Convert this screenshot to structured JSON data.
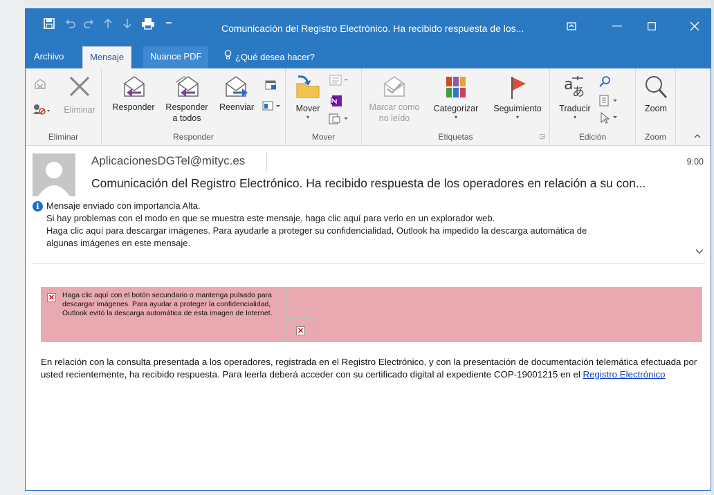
{
  "window": {
    "title": "Comunicación del Registro Electrónico. Ha recibido respuesta de los..."
  },
  "quick_access": {
    "icons": [
      "save-icon",
      "undo-icon",
      "redo-icon",
      "up-arrow-icon",
      "down-arrow-icon",
      "print-icon",
      "customize-icon"
    ]
  },
  "tabs": {
    "file": "Archivo",
    "message": "Mensaje",
    "nuance": "Nuance PDF",
    "tell_me": "¿Qué desea hacer?"
  },
  "ribbon": {
    "eliminar": {
      "delete_label": "Eliminar",
      "group_label": "Eliminar"
    },
    "responder": {
      "reply_label": "Responder",
      "reply_all_line1": "Responder",
      "reply_all_line2": "a todos",
      "forward_label": "Reenviar",
      "group_label": "Responder"
    },
    "mover": {
      "move_label": "Mover",
      "group_label": "Mover"
    },
    "etiquetas": {
      "mark_unread_line1": "Marcar como",
      "mark_unread_line2": "no leído",
      "categorize_label": "Categorizar",
      "followup_label": "Seguimiento",
      "group_label": "Etiquetas"
    },
    "edicion": {
      "translate_label": "Traducir",
      "group_label": "Edición"
    },
    "zoom": {
      "zoom_label": "Zoom",
      "group_label": "Zoom"
    }
  },
  "message": {
    "sender": "AplicacionesDGTel@mityc.es",
    "time": "9:00",
    "subject": "Comunicación del Registro Electrónico. Ha recibido respuesta de los operadores en relación a su con...",
    "info_lines": [
      "Mensaje enviado con importancia Alta.",
      "Si hay problemas con el modo en que se muestra este mensaje, haga clic aquí para verlo en un explorador web.",
      "Haga clic aquí para descargar imágenes. Para ayudarle a proteger su confidencialidad, Outlook ha impedido la descarga automática de",
      "algunas imágenes en este mensaje."
    ],
    "blocked_image_text": "Haga clic aquí con el botón secundario o mantenga pulsado para descargar imágenes. Para ayudar a proteger la confidencialidad, Outlook evitó la descarga automática de esta imagen de Internet.",
    "body_text": "En relación con la consulta presentada a los operadores, registrada en el Registro Electrónico, y con la presentación de documentación telemática efectuada por usted recientemente, ha recibido respuesta. Para leerla deberá acceder con su certificado digital al expediente COP-19001215 en el ",
    "body_link": "Registro Electrónico"
  },
  "colors": {
    "title_blue": "#2b79c2",
    "banner_pink": "#e8a9b1",
    "link_blue": "#0b3cc1"
  }
}
